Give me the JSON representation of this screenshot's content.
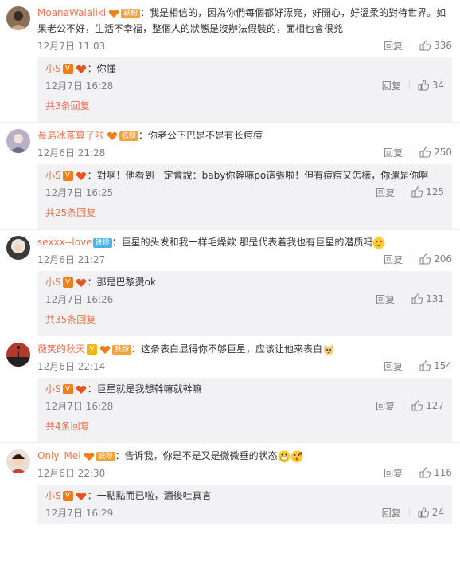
{
  "reply_label": "回复",
  "comments": [
    {
      "user": "MoanaWaialiki",
      "badge_fan": "铁粉",
      "text": "：我是相信的，因為你們每個都好漂亮，好開心，好溫柔的對待世界。如果老公不好，生活不幸福，整個人的狀態是沒辦法假裝的，面相也會很兇",
      "time": "12月7日 11:03",
      "likes": "336",
      "reply": {
        "user": "小S",
        "text": "：你懂",
        "time": "12月7日 16:28",
        "likes": "34"
      },
      "more": "共3条回复"
    },
    {
      "user": "長島冰茶算了啦",
      "badge_fan": "铁粉",
      "text": "：你老公下巴是不是有长痘痘",
      "time": "12月6日 21:28",
      "likes": "250",
      "reply": {
        "user": "小S",
        "text": "：對啊！他看到一定會說：baby你幹嘛po這張啦！但有痘痘又怎樣，你還是你啊",
        "time": "12月7日 16:25",
        "likes": "125"
      },
      "more": "共25条回复"
    },
    {
      "user": "sexxx--love",
      "badge_fan": "铁粉",
      "text": "：巨星的头发和我一样毛燥欸 那是代表着我也有巨星的潜质吗",
      "time": "12月6日 21:27",
      "likes": "206",
      "reply": {
        "user": "小S",
        "text": "：那是巴黎燙ok",
        "time": "12月7日 16:26",
        "likes": "131"
      },
      "more": "共35条回复"
    },
    {
      "user": "薇笑的秋天",
      "badge_fan": "铁粉",
      "text": "：这条表白显得你不够巨星，应该让他来表白",
      "time": "12月6日 22:14",
      "likes": "154",
      "reply": {
        "user": "小S",
        "text": "：巨星就是我想幹嘛就幹嘛",
        "time": "12月7日 16:28",
        "likes": "127"
      },
      "more": "共4条回复"
    },
    {
      "user": "Only_Mei",
      "badge_fan": "铁粉",
      "text": "：告诉我，你是不是又是微微垂的状态",
      "time": "12月6日 22:30",
      "likes": "116",
      "reply": {
        "user": "小S",
        "text": "：一點點而已啦，酒後吐真言",
        "time": "12月7日 16:29",
        "likes": "24"
      },
      "more": ""
    }
  ],
  "colors": {
    "username": "#eb7350",
    "reply_bg": "#f2f2f5",
    "meta": "#808080"
  }
}
